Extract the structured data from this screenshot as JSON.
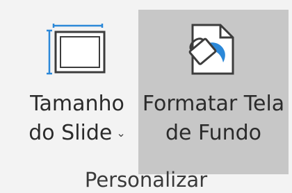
{
  "ribbon_group": {
    "label": "Personalizar",
    "buttons": [
      {
        "line1": "Tamanho",
        "line2": "do Slide",
        "has_dropdown": true,
        "dropdown_glyph": "⌄",
        "icon": "slide-size-icon"
      },
      {
        "line1": "Formatar Tela",
        "line2": "de Fundo",
        "has_dropdown": false,
        "icon": "format-background-icon",
        "state": "hovered"
      }
    ]
  },
  "colors": {
    "background": "#f3f3f3",
    "hover": "#c7c7c7",
    "accent": "#2b88d8",
    "text": "#2b2b2b"
  }
}
